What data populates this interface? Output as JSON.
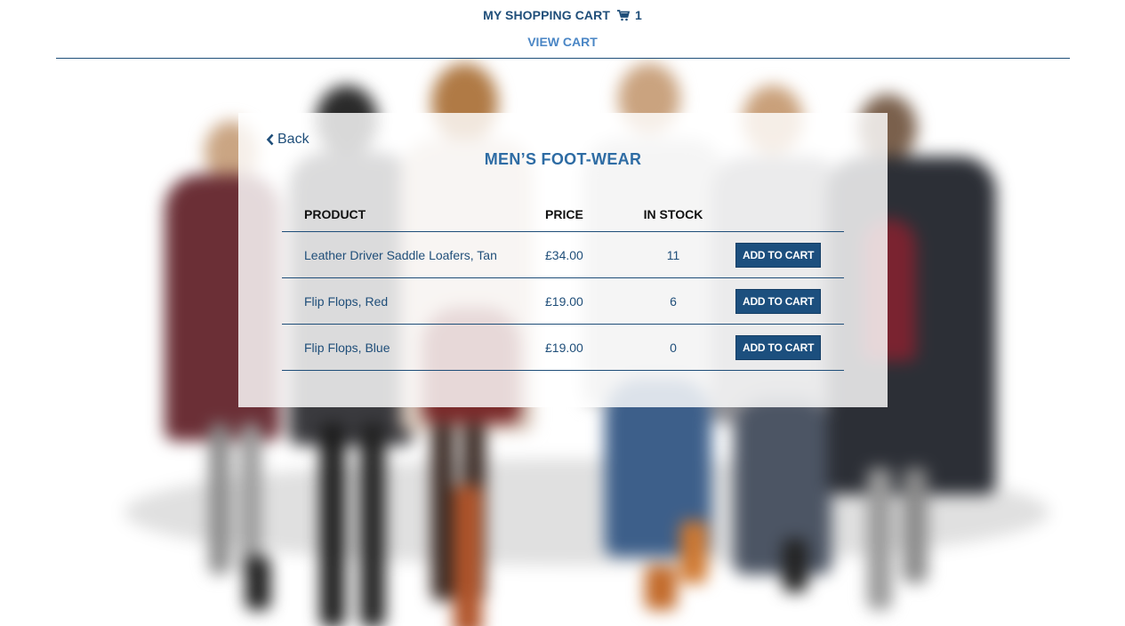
{
  "header": {
    "cart_label": "MY SHOPPING CART",
    "cart_count": "1",
    "view_cart_label": "VIEW CART",
    "brand_color": "#1f4e79",
    "link_color": "#4a86c5"
  },
  "panel": {
    "back_label": "Back",
    "title": "MEN’S FOOT-WEAR",
    "columns": [
      "PRODUCT",
      "PRICE",
      "IN STOCK"
    ],
    "rows": [
      {
        "product": "Leather Driver Saddle Loafers, Tan",
        "price": "£34.00",
        "stock": "11",
        "action": "ADD TO CART"
      },
      {
        "product": "Flip Flops, Red",
        "price": "£19.00",
        "stock": "6",
        "action": "ADD TO CART"
      },
      {
        "product": "Flip Flops, Blue",
        "price": "£19.00",
        "stock": "0",
        "action": "ADD TO CART"
      }
    ]
  },
  "icons": {
    "cart": "shopping-cart-icon",
    "back": "chevron-left-icon"
  }
}
